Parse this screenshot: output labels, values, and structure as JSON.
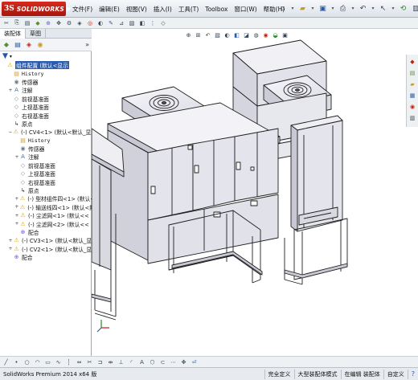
{
  "app": {
    "logo_text": "SOLIDWORKS",
    "menu": [
      "文件(F)",
      "编辑(E)",
      "视图(V)",
      "插入(I)",
      "工具(T)",
      "Toolbox",
      "窗口(W)",
      "帮助(H)"
    ]
  },
  "panel": {
    "tabs": [
      "装配体",
      "草图"
    ],
    "more_label": "»",
    "tree": [
      {
        "indent": 0,
        "exp": "",
        "icon": "warning-assembly-icon",
        "glyph": "⚠",
        "cls": "ic-warn",
        "text": "组件配置  (默认<显示",
        "selected": true
      },
      {
        "indent": 1,
        "exp": "",
        "icon": "history-icon",
        "glyph": "▤",
        "cls": "ic-folder",
        "text": "History",
        "mono": true
      },
      {
        "indent": 1,
        "exp": "",
        "icon": "sensor-icon",
        "glyph": "◉",
        "cls": "ic-sensor",
        "text": "传感器"
      },
      {
        "indent": 1,
        "exp": "+",
        "icon": "annotation-icon",
        "glyph": "A",
        "cls": "ic-note",
        "text": "注解"
      },
      {
        "indent": 1,
        "exp": "",
        "icon": "plane-icon",
        "glyph": "◇",
        "cls": "ic-plane",
        "text": "前视基准面"
      },
      {
        "indent": 1,
        "exp": "",
        "icon": "plane-icon",
        "glyph": "◇",
        "cls": "ic-plane",
        "text": "上视基准面"
      },
      {
        "indent": 1,
        "exp": "",
        "icon": "plane-icon",
        "glyph": "◇",
        "cls": "ic-plane",
        "text": "右视基准面"
      },
      {
        "indent": 1,
        "exp": "",
        "icon": "origin-icon",
        "glyph": "↳",
        "cls": "ic-origin",
        "text": "原点"
      },
      {
        "indent": 1,
        "exp": "−",
        "icon": "subassembly-icon",
        "glyph": "⚠",
        "cls": "ic-warn",
        "text": "(-) CV4<1> (默认<默认_显示"
      },
      {
        "indent": 2,
        "exp": "",
        "icon": "history-icon",
        "glyph": "▤",
        "cls": "ic-folder",
        "text": "History",
        "mono": true
      },
      {
        "indent": 2,
        "exp": "",
        "icon": "sensor-icon",
        "glyph": "◉",
        "cls": "ic-sensor",
        "text": "传感器"
      },
      {
        "indent": 2,
        "exp": "+",
        "icon": "annotation-icon",
        "glyph": "A",
        "cls": "ic-note",
        "text": "注解"
      },
      {
        "indent": 2,
        "exp": "",
        "icon": "plane-icon",
        "glyph": "◇",
        "cls": "ic-plane",
        "text": "前视基准面"
      },
      {
        "indent": 2,
        "exp": "",
        "icon": "plane-icon",
        "glyph": "◇",
        "cls": "ic-plane",
        "text": "上视基准面"
      },
      {
        "indent": 2,
        "exp": "",
        "icon": "plane-icon",
        "glyph": "◇",
        "cls": "ic-plane",
        "text": "右视基准面"
      },
      {
        "indent": 2,
        "exp": "",
        "icon": "origin-icon",
        "glyph": "↳",
        "cls": "ic-origin",
        "text": "原点"
      },
      {
        "indent": 2,
        "exp": "+",
        "icon": "part-icon",
        "glyph": "⚠",
        "cls": "ic-warn",
        "text": "(-) 型材组件四<1> (默认<"
      },
      {
        "indent": 2,
        "exp": "+",
        "icon": "part-icon",
        "glyph": "⚠",
        "cls": "ic-warn",
        "text": "(-) 输送线四<1> (默认<默"
      },
      {
        "indent": 2,
        "exp": "+",
        "icon": "part-icon",
        "glyph": "⚠",
        "cls": "ic-warn",
        "text": "(-) 尘滤网<1> (默认<<"
      },
      {
        "indent": 2,
        "exp": "+",
        "icon": "part-icon",
        "glyph": "⚠",
        "cls": "ic-warn",
        "text": "(-) 尘滤网<2> (默认<<"
      },
      {
        "indent": 2,
        "exp": "",
        "icon": "mates-icon",
        "glyph": "⊕",
        "cls": "ic-mate",
        "text": "配合"
      },
      {
        "indent": 1,
        "exp": "+",
        "icon": "subassembly-icon",
        "glyph": "⚠",
        "cls": "ic-warn",
        "text": "(-) CV3<1> (默认<默认_显"
      },
      {
        "indent": 1,
        "exp": "+",
        "icon": "subassembly-icon",
        "glyph": "⚠",
        "cls": "ic-warn",
        "text": "(-) CV2<1> (默认<默认_显"
      },
      {
        "indent": 1,
        "exp": "",
        "icon": "mates-icon",
        "glyph": "⊕",
        "cls": "ic-mate",
        "text": "配合"
      }
    ]
  },
  "status": {
    "left": "SolidWorks Premium 2014 x64 版",
    "cells": [
      "完全定义",
      "大型装配体模式",
      "在编辑 装配体",
      "自定义"
    ],
    "help": "?"
  },
  "colors": {
    "accent": "#2a5db0",
    "brand": "#c4200f",
    "model_face": "#e4e5ec",
    "model_shade": "#c7c8d3",
    "model_edge": "#202020"
  }
}
